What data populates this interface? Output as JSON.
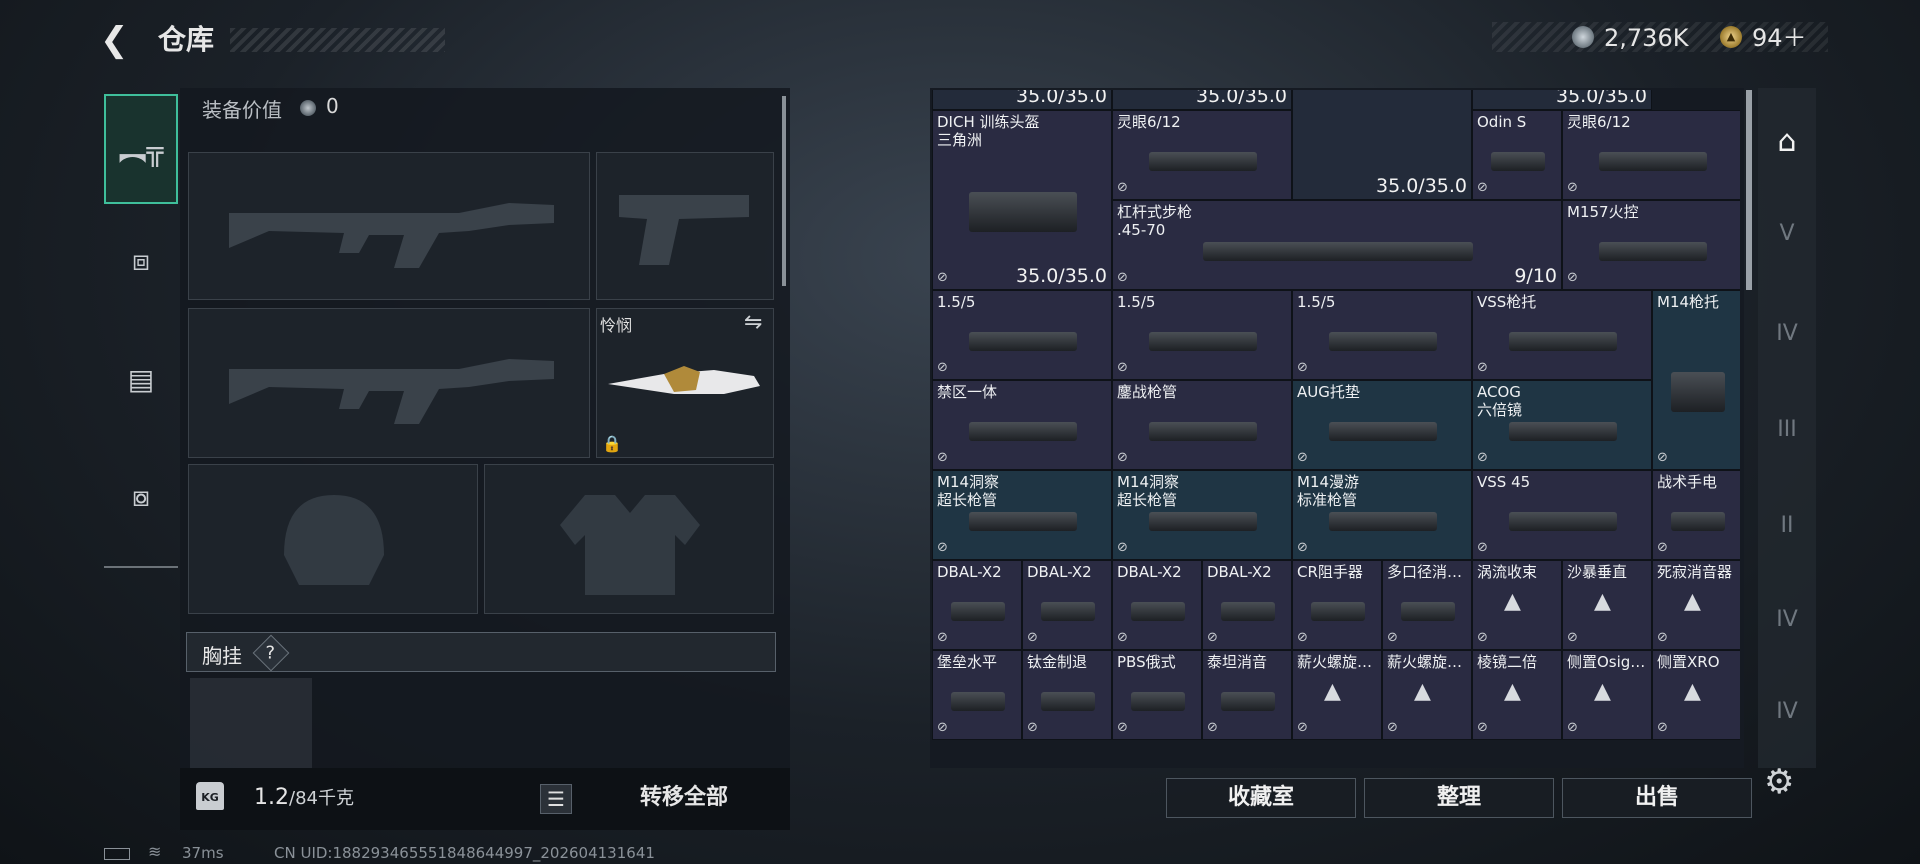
{
  "header": {
    "back_icon": "back-arrow-icon",
    "title": "仓库",
    "cash": "2,736K",
    "gold": "94＋",
    "gold_coin_glyph": "▲"
  },
  "rail": {
    "items": [
      {
        "icon": "pistol-icon",
        "glyph": "︻╦",
        "active": true
      },
      {
        "icon": "backpack-icon",
        "glyph": "⧈"
      },
      {
        "icon": "clipboard-icon",
        "glyph": "▤"
      },
      {
        "icon": "toolbox-icon",
        "glyph": "⧇"
      }
    ]
  },
  "loadout": {
    "equip_label": "装备价值",
    "equip_value": "0",
    "knife_name": "怜悯",
    "swap_glyph": "⇋",
    "lock_glyph": "🔒",
    "chest_label": "胸挂",
    "chest_help": "?",
    "weight": "1.2",
    "weight_unit": "/84千克",
    "weight_icon_text": "KG",
    "list_glyph": "☰",
    "transfer_label": "转移全部"
  },
  "status": {
    "ping": "37ms",
    "uid": "CN UID:188293465551848644997_202604131641",
    "wifi_glyph": "≋"
  },
  "grid": {
    "cells": [
      {
        "id": "top-durability-a",
        "dur": "35.0/35.0",
        "cls": "dark"
      },
      {
        "id": "top-durability-b",
        "dur": "35.0/35.0",
        "cls": "dark"
      },
      {
        "id": "top-helmet",
        "dur": "35.0/35.0",
        "cls": "dark"
      },
      {
        "id": "top-durability-c",
        "dur": "35.0/35.0",
        "cls": "dark"
      },
      {
        "id": "dich-helmet",
        "name": "DICH 训练头盔\n三角洲",
        "dur": "35.0/35.0"
      },
      {
        "id": "scope-6-12-a",
        "name": "灵眼6/12"
      },
      {
        "id": "odin-s",
        "name": "Odin S"
      },
      {
        "id": "scope-6-12-b",
        "name": "灵眼6/12"
      },
      {
        "id": "lever-rifle",
        "name": "杠杆式步枪\n.45-70",
        "dur": "9/10"
      },
      {
        "id": "m157",
        "name": "M157火控"
      },
      {
        "id": "scope-15-a",
        "name": "1.5/5"
      },
      {
        "id": "scope-15-b",
        "name": "1.5/5"
      },
      {
        "id": "scope-15-c",
        "name": "1.5/5"
      },
      {
        "id": "vss-stock",
        "name": "VSS枪托"
      },
      {
        "id": "m14-stock",
        "name": "M14枪托",
        "cls": "teal"
      },
      {
        "id": "exclusion-grip",
        "name": "禁区一体"
      },
      {
        "id": "melee-barrel",
        "name": "鏖战枪管"
      },
      {
        "id": "aug-pad",
        "name": "AUG托垫",
        "cls": "teal"
      },
      {
        "id": "acog",
        "name": "ACOG\n六倍镜",
        "cls": "teal"
      },
      {
        "id": "m14-recon-a",
        "name": "M14洞察\n超长枪管",
        "cls": "teal"
      },
      {
        "id": "m14-recon-b",
        "name": "M14洞察\n超长枪管",
        "cls": "teal"
      },
      {
        "id": "m14-roam",
        "name": "M14漫游\n标准枪管",
        "cls": "teal"
      },
      {
        "id": "vss-45",
        "name": "VSS 45"
      },
      {
        "id": "tac-light",
        "name": "战术手电"
      },
      {
        "id": "dbal-1",
        "name": "DBAL-X2"
      },
      {
        "id": "dbal-2",
        "name": "DBAL-X2"
      },
      {
        "id": "dbal-3",
        "name": "DBAL-X2"
      },
      {
        "id": "dbal-4",
        "name": "DBAL-X2"
      },
      {
        "id": "cr-brake",
        "name": "CR阻手器"
      },
      {
        "id": "multi-cal",
        "name": "多口径消…"
      },
      {
        "id": "vortex",
        "name": "涡流收束",
        "tri": true
      },
      {
        "id": "sandstorm",
        "name": "沙暴垂直",
        "tri": true
      },
      {
        "id": "silent-sup",
        "name": "死寂消音器",
        "tri": true
      },
      {
        "id": "fort-level",
        "name": "堡垒水平"
      },
      {
        "id": "ti-brake",
        "name": "钛金制退"
      },
      {
        "id": "pbs",
        "name": "PBS俄式"
      },
      {
        "id": "titan-sup",
        "name": "泰坦消音"
      },
      {
        "id": "ember-a",
        "name": "薪火螺旋…",
        "tri": true
      },
      {
        "id": "ember-b",
        "name": "薪火螺旋…",
        "tri": true
      },
      {
        "id": "prism-2x",
        "name": "棱镜二倍",
        "tri": true
      },
      {
        "id": "side-osig",
        "name": "侧置Osig…",
        "tri": true
      },
      {
        "id": "side-xro",
        "name": "侧置XRO",
        "tri": true
      }
    ]
  },
  "tools": [
    "vault-icon",
    "cat-v-icon",
    "cat-iv-icon",
    "cat-iii-icon",
    "cat-ii-icon",
    "cat-iv-b-icon",
    "cat-iv-c-icon"
  ],
  "tool_glyphs": [
    "⌂",
    "V",
    "IV",
    "III",
    "II",
    "IV",
    "IV"
  ],
  "actions": {
    "collection": "收藏室",
    "organize": "整理",
    "sell": "出售",
    "settings_glyph": "⚙"
  }
}
